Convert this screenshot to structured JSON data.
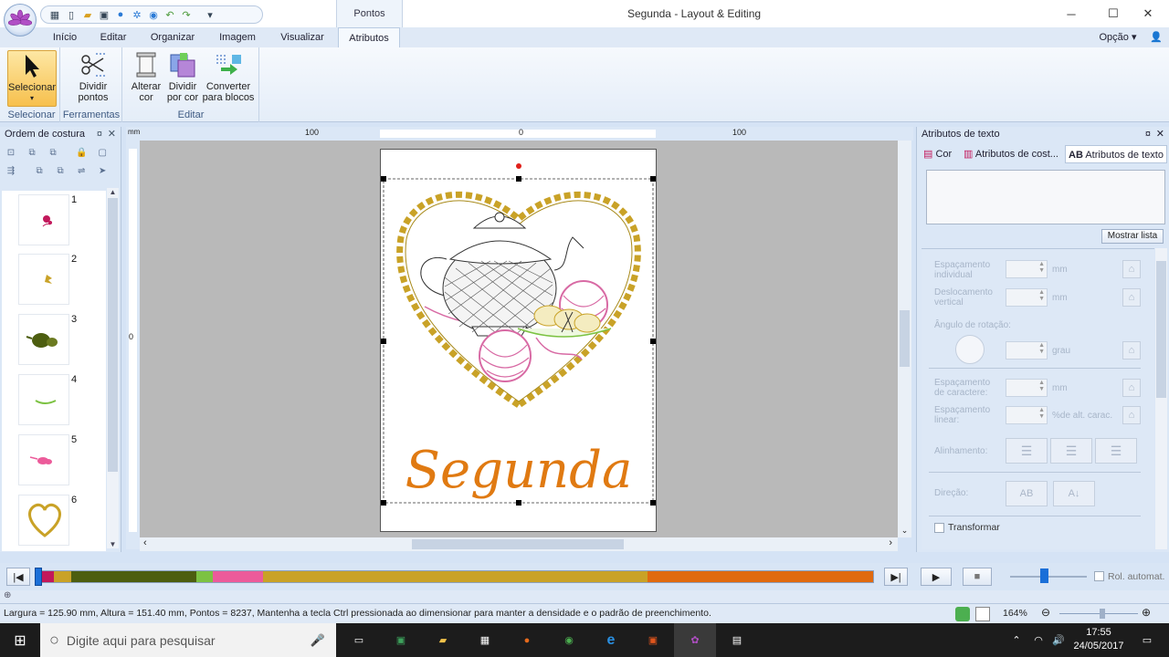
{
  "window": {
    "title": "Segunda - Layout & Editing",
    "context_tab": "Pontos",
    "minimize": "─",
    "maximize": "☐",
    "close": "✕"
  },
  "quick_access": [
    "grid-icon",
    "new-icon",
    "open-icon",
    "save-icon",
    "circle-icon",
    "gear-icon",
    "view-icon",
    "undo-icon",
    "redo-icon",
    "customize-icon"
  ],
  "ribbon_tabs": [
    "Início",
    "Editar",
    "Organizar",
    "Imagem",
    "Visualizar",
    "Atributos"
  ],
  "active_tab": "Atributos",
  "option_label": "Opção",
  "ribbon": {
    "selecionar_group": "Selecionar",
    "selecionar_btn": "Selecionar",
    "ferramentas_group": "Ferramentas",
    "dividir_pontos": [
      "Dividir",
      "pontos"
    ],
    "editar_group": "Editar",
    "alterar_cor": [
      "Alterar",
      "cor"
    ],
    "dividir_por_cor": [
      "Dividir",
      "por cor"
    ],
    "converter_blocos": [
      "Converter",
      "para blocos"
    ]
  },
  "left_panel": {
    "title": "Ordem de costura",
    "items": [
      {
        "num": "1",
        "color": "#c2185b"
      },
      {
        "num": "2",
        "color": "#c9a227"
      },
      {
        "num": "3",
        "color": "#4d5e10"
      },
      {
        "num": "4",
        "color": "#7cc242"
      },
      {
        "num": "5",
        "color": "#ec5b9a"
      },
      {
        "num": "6",
        "color": "#c9a227"
      }
    ]
  },
  "rulers": {
    "h_labels": [
      "100",
      "0",
      "100"
    ],
    "v_label": "0",
    "corner": "mm"
  },
  "design": {
    "text": "Segunda",
    "text_color": "#e07a12",
    "gold": "#c9a227",
    "pink": "#d86aa4"
  },
  "right_panel": {
    "title": "Atributos de texto",
    "tabs": [
      "Cor",
      "Atributos de cost...",
      "Atributos de texto"
    ],
    "show_list": "Mostrar lista",
    "fields": [
      {
        "label": [
          "Espaçamento",
          "individual"
        ],
        "unit": "mm"
      },
      {
        "label": [
          "Deslocamento",
          "vertical"
        ],
        "unit": "mm"
      },
      {
        "label": [
          "Ângulo de rotação:"
        ],
        "unit": "grau"
      },
      {
        "label": [
          "Espaçamento",
          "de caractere:"
        ],
        "unit": "mm"
      },
      {
        "label": [
          "Espaçamento",
          "linear:"
        ],
        "unit": "%de alt. carac."
      }
    ],
    "alignment_label": "Alinhamento:",
    "direction_label": "Direção:",
    "direction_btn_1": "AB",
    "direction_btn_2": "A↓",
    "transform_label": "Transformar"
  },
  "player": {
    "colors": [
      {
        "color": "#c2185b",
        "w": 2
      },
      {
        "color": "#c9a227",
        "w": 2
      },
      {
        "color": "#4d5e10",
        "w": 15
      },
      {
        "color": "#7cc242",
        "w": 2
      },
      {
        "color": "#ec5b9a",
        "w": 6
      },
      {
        "color": "#c9a227",
        "w": 46
      },
      {
        "color": "#e06a10",
        "w": 27
      }
    ],
    "auto_scroll": "Rol. automat."
  },
  "status": {
    "text": "Largura = 125.90 mm, Altura = 151.40 mm, Pontos = 8237, Mantenha a tecla Ctrl pressionada ao dimensionar para manter a densidade e o padrão de preenchimento.",
    "zoom": "164%"
  },
  "taskbar": {
    "search_placeholder": "Digite aqui para pesquisar",
    "time": "17:55",
    "date": "24/05/2017"
  }
}
